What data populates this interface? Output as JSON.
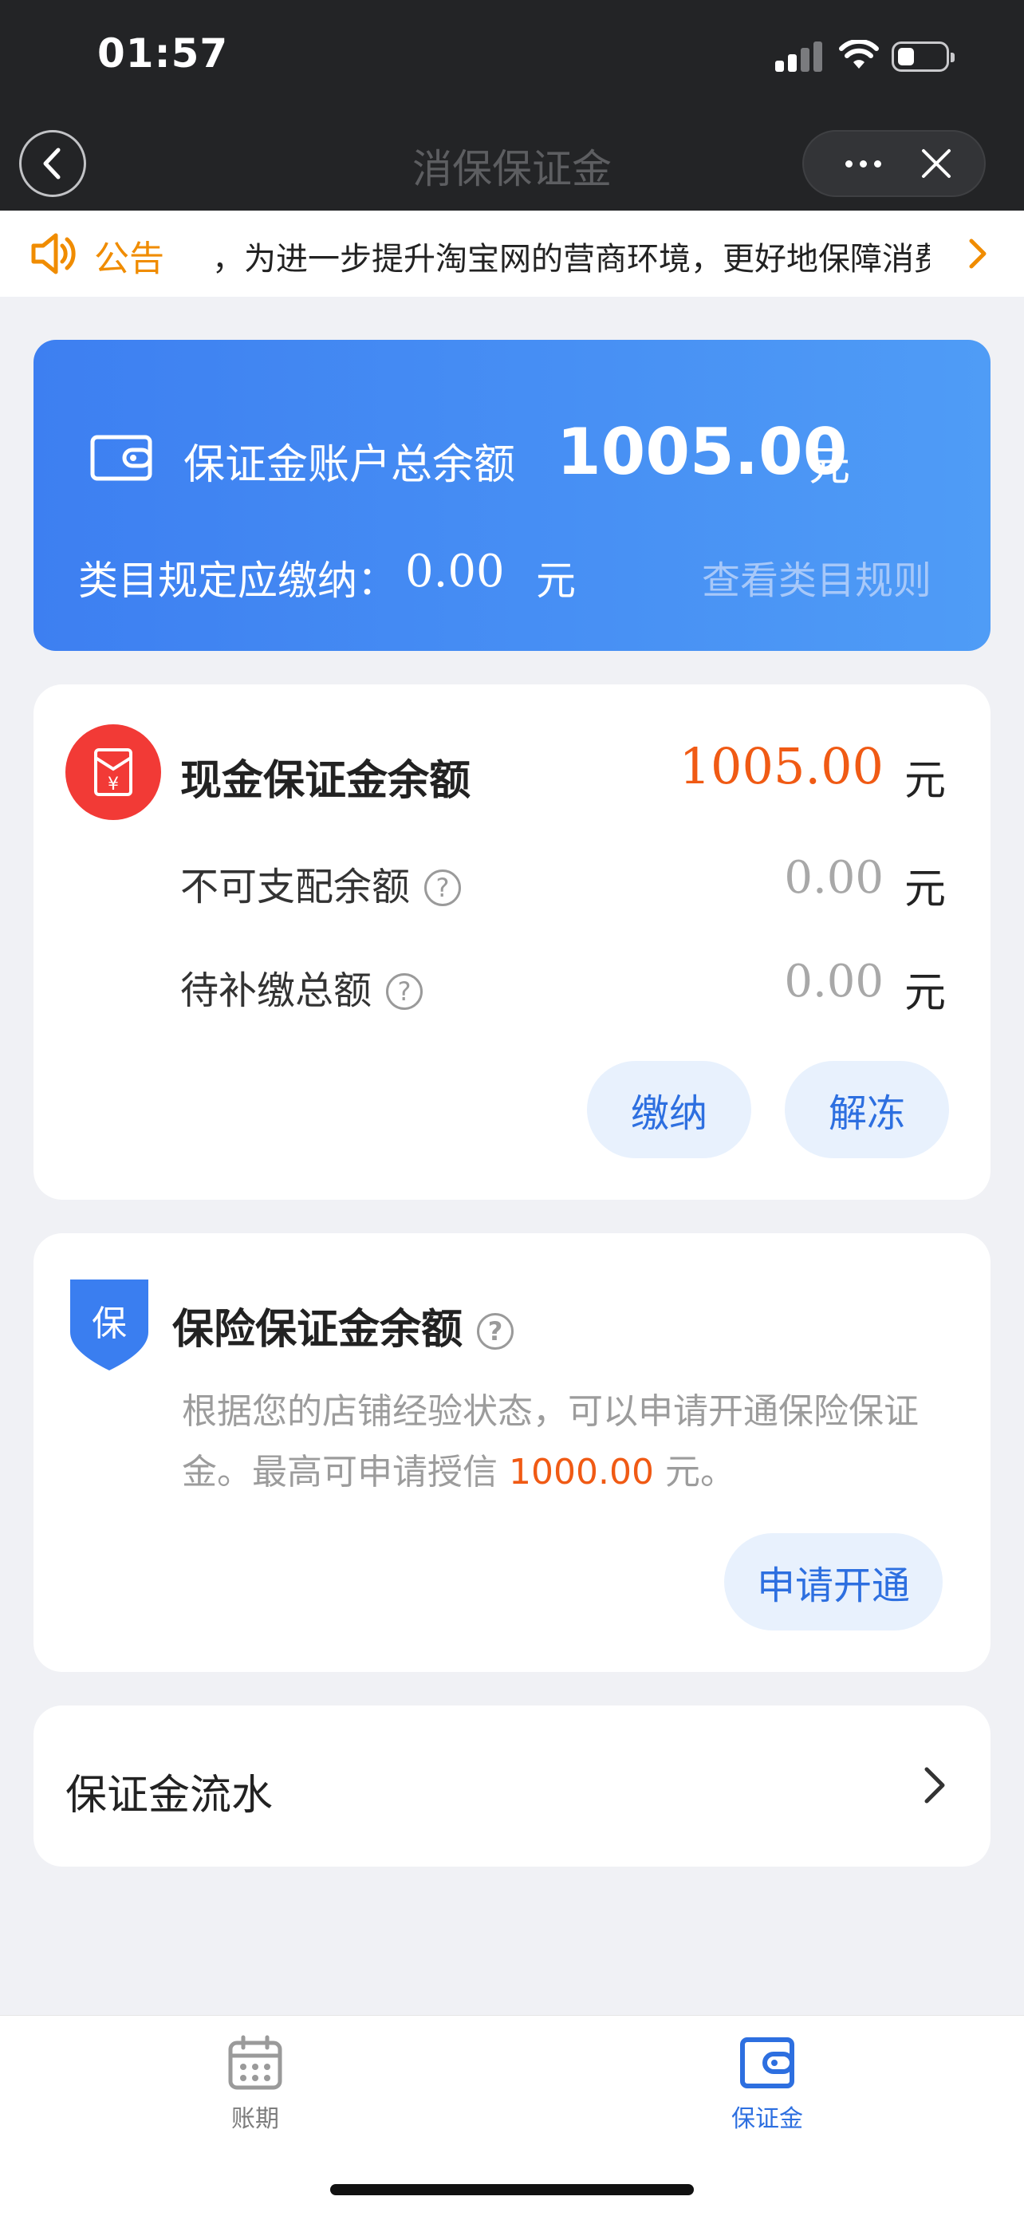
{
  "status_bar": {
    "time": "01:57"
  },
  "nav": {
    "title": "消保保证金"
  },
  "notice": {
    "label": "公告",
    "text": "，为进一步提升淘宝网的营商环境，更好地保障消费者权益"
  },
  "summary": {
    "total_label": "保证金账户总余额",
    "total_value": "1005.00",
    "total_unit": "元",
    "required_label": "类目规定应缴纳：",
    "required_value": "0.00",
    "required_unit": "元",
    "rule_link": "查看类目规则"
  },
  "cash": {
    "icon_glyph": "¥",
    "title": "现金保证金余额",
    "balance": "1005.00",
    "unit": "元",
    "rows": [
      {
        "label": "不可支配余额",
        "value": "0.00",
        "unit": "元"
      },
      {
        "label": "待补缴总额",
        "value": "0.00",
        "unit": "元"
      }
    ],
    "pay_button": "缴纳",
    "unfreeze_button": "解冻"
  },
  "insurance": {
    "shield_glyph": "保",
    "title": "保险保证金余额",
    "desc_before": "根据您的店铺经验状态，可以申请开通保险保证金。最高可申请授信 ",
    "credit_amount": "1000.00",
    "desc_after": " 元。",
    "apply_button": "申请开通"
  },
  "flow": {
    "label": "保证金流水"
  },
  "help_glyph": "?",
  "tabbar": {
    "tabs": [
      {
        "label": "账期",
        "icon": "calendar-icon",
        "active": false
      },
      {
        "label": "保证金",
        "icon": "wallet-icon",
        "active": true
      }
    ]
  },
  "colors": {
    "accent_blue": "#2d6fe0",
    "highlight_orange": "#f05a14",
    "notice_orange": "#f08c00",
    "cash_red": "#f23a36",
    "tab_inactive": "#9a9a9a"
  }
}
